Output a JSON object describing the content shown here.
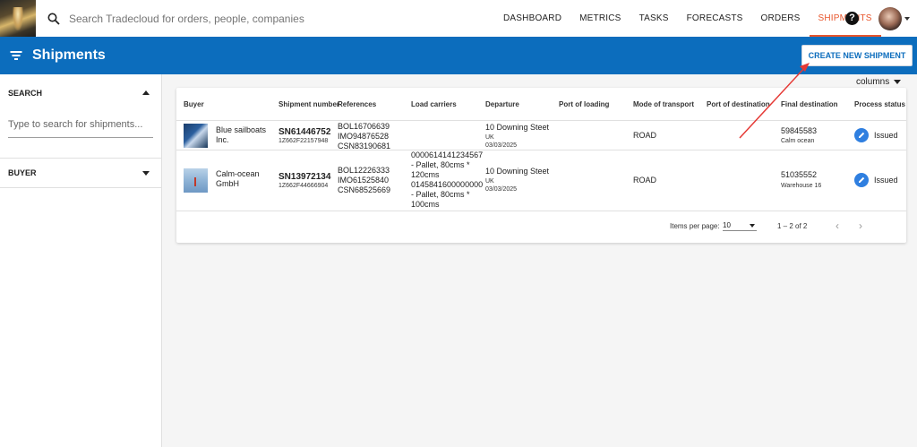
{
  "topbar": {
    "search_placeholder": "Search Tradecloud for orders, people, companies",
    "nav": [
      "DASHBOARD",
      "METRICS",
      "TASKS",
      "FORECASTS",
      "ORDERS",
      "SHIPMENTS"
    ],
    "active_nav": "SHIPMENTS",
    "help_label": "?"
  },
  "header": {
    "title": "Shipments",
    "create_button": "CREATE NEW SHIPMENT"
  },
  "sidebar": {
    "search_title": "SEARCH",
    "search_placeholder": "Type to search for shipments...",
    "buyer_title": "BUYER"
  },
  "table": {
    "columns_button": "columns",
    "headers": [
      "Buyer",
      "Shipment number",
      "References",
      "Load carriers",
      "Departure",
      "Port of loading",
      "Mode of transport",
      "Port of destination",
      "Final destination",
      "Process status"
    ],
    "rows": [
      {
        "buyer": "Blue sailboats Inc.",
        "shipment_number": "SN61446752",
        "shipment_sub": "1Z662F22157948",
        "references": [
          "BOL16706639",
          "IMO94876528",
          "CSN83190681"
        ],
        "load_carriers": "",
        "departure_address": "10 Downing Steet",
        "departure_country": "UK",
        "departure_date": "03/03/2025",
        "port_of_loading": "",
        "mode_of_transport": "ROAD",
        "port_of_destination": "",
        "final_destination": "59845583",
        "final_destination_sub": "Calm ocean",
        "status": "Issued"
      },
      {
        "buyer": "Calm-ocean GmbH",
        "shipment_number": "SN13972134",
        "shipment_sub": "1Z662F44666904",
        "references": [
          "BOL12226333",
          "IMO61525840",
          "CSN68525669"
        ],
        "load_carriers": [
          "0000614141234567",
          "- Pallet, 80cms *",
          "120cms",
          "0145841600000000",
          "- Pallet, 80cms *",
          "100cms"
        ],
        "departure_address": "10 Downing Steet",
        "departure_country": "UK",
        "departure_date": "03/03/2025",
        "port_of_loading": "",
        "mode_of_transport": "ROAD",
        "port_of_destination": "",
        "final_destination": "51035552",
        "final_destination_sub": "Warehouse 16",
        "status": "Issued"
      }
    ],
    "paginator": {
      "items_per_page_label": "Items per page:",
      "items_per_page": "10",
      "range": "1 – 2 of 2"
    }
  },
  "colors": {
    "brand_blue": "#0c6dbd",
    "active_nav": "#e8552b",
    "status_blue": "#2f7fe0",
    "annotation_arrow": "#e53935"
  }
}
